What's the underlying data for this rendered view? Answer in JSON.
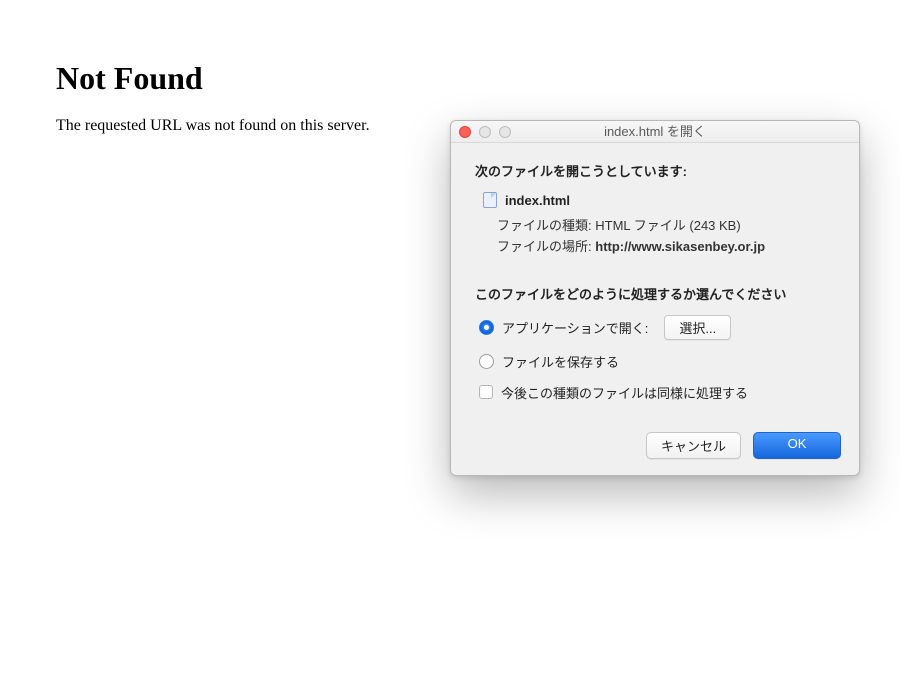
{
  "page": {
    "heading": "Not Found",
    "message": "The requested URL was not found on this server."
  },
  "dialog": {
    "title": "index.html を開く",
    "lead": "次のファイルを開こうとしています:",
    "file": {
      "name": "index.html",
      "type_label": "ファイルの種類:",
      "type_value": "HTML ファイル (243 KB)",
      "location_label": "ファイルの場所:",
      "location_value": "http://www.sikasenbey.or.jp"
    },
    "question": "このファイルをどのように処理するか選んでください",
    "options": {
      "open_with": "アプリケーションで開く:",
      "choose": "選択...",
      "save": "ファイルを保存する"
    },
    "remember": "今後この種類のファイルは同様に処理する",
    "buttons": {
      "cancel": "キャンセル",
      "ok": "OK"
    }
  }
}
